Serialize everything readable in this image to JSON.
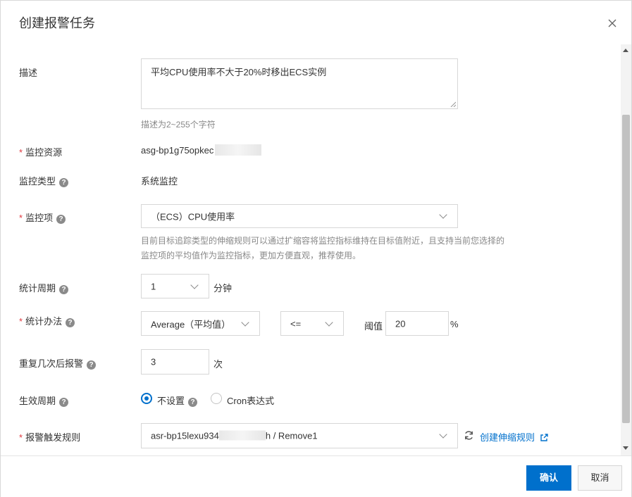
{
  "dialog": {
    "title": "创建报警任务",
    "confirm_label": "确认",
    "cancel_label": "取消"
  },
  "form": {
    "description": {
      "label": "描述",
      "value": "平均CPU使用率不大于20%时移出ECS实例",
      "hint": "描述为2~255个字符"
    },
    "monitor_resource": {
      "label": "监控资源",
      "value": "asg-bp1g75opkec"
    },
    "monitor_type": {
      "label": "监控类型",
      "value": "系统监控"
    },
    "monitor_item": {
      "label": "监控项",
      "value": "（ECS）CPU使用率",
      "hint_line1": "目前目标追踪类型的伸缩规则可以通过扩缩容将监控指标维持在目标值附近，且支持当前您选择的",
      "hint_line2": "监控项的平均值作为监控指标，更加方便直观，推荐使用。"
    },
    "stat_period": {
      "label": "统计周期",
      "value": "1",
      "unit": "分钟"
    },
    "stat_method": {
      "label": "统计办法",
      "method": "Average（平均值）",
      "operator": "<=",
      "threshold_label": "阈值",
      "threshold": "20",
      "unit": "%"
    },
    "repeat": {
      "label": "重复几次后报警",
      "value": "3",
      "unit": "次"
    },
    "effective_period": {
      "label": "生效周期",
      "option_none": "不设置",
      "option_cron": "Cron表达式",
      "selected": "不设置"
    },
    "trigger_rule": {
      "label": "报警触发规则",
      "value_prefix": "asr-bp15lexu934",
      "value_suffix": "h / Remove1",
      "create_link": "创建伸缩规则"
    }
  },
  "help_glyph": "?",
  "colors": {
    "primary": "#0070cc",
    "required": "#e0383e"
  }
}
